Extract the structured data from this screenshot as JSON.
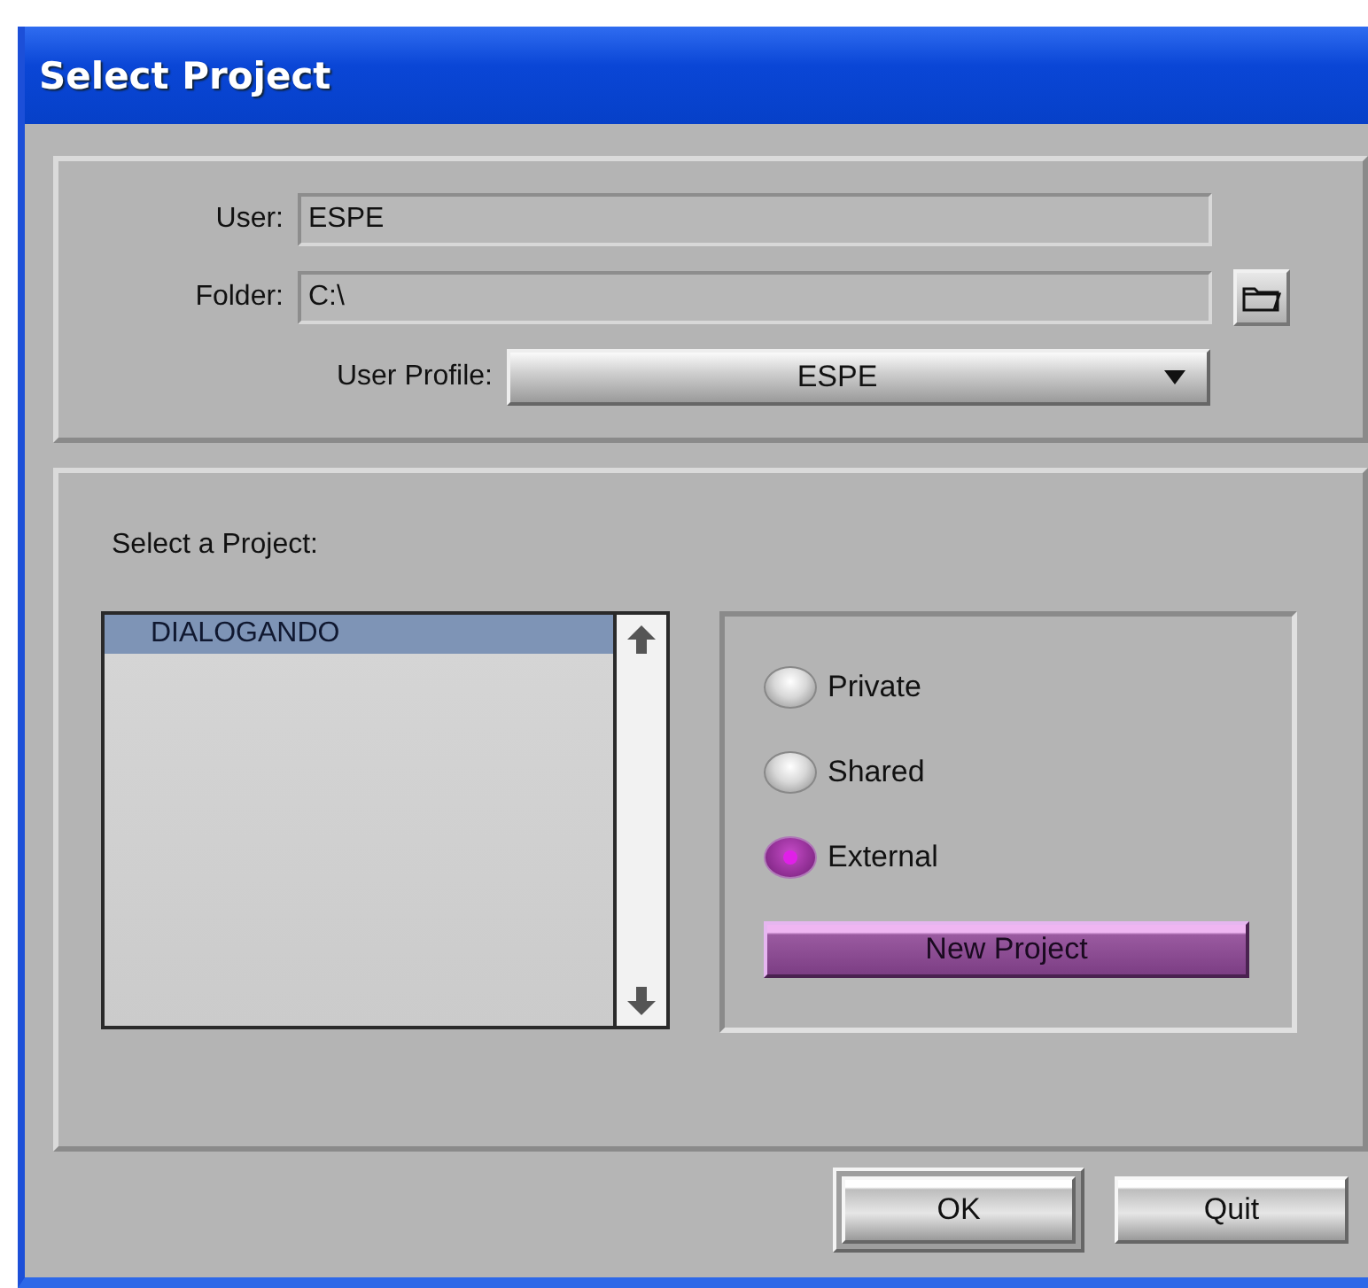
{
  "window": {
    "title": "Select Project"
  },
  "user": {
    "label": "User:",
    "value": "ESPE"
  },
  "folder": {
    "label": "Folder:",
    "value": "C:\\"
  },
  "user_profile": {
    "label": "User Profile:",
    "value": "ESPE"
  },
  "projects": {
    "label": "Select a Project:",
    "items": [
      {
        "name": "DIALOGANDO",
        "selected": true
      }
    ]
  },
  "project_types": [
    {
      "label": "Private",
      "selected": false
    },
    {
      "label": "Shared",
      "selected": false
    },
    {
      "label": "External",
      "selected": true
    }
  ],
  "new_project_button": "New Project",
  "buttons": [
    {
      "label": "OK",
      "default": true
    },
    {
      "label": "Quit",
      "default": false
    }
  ]
}
